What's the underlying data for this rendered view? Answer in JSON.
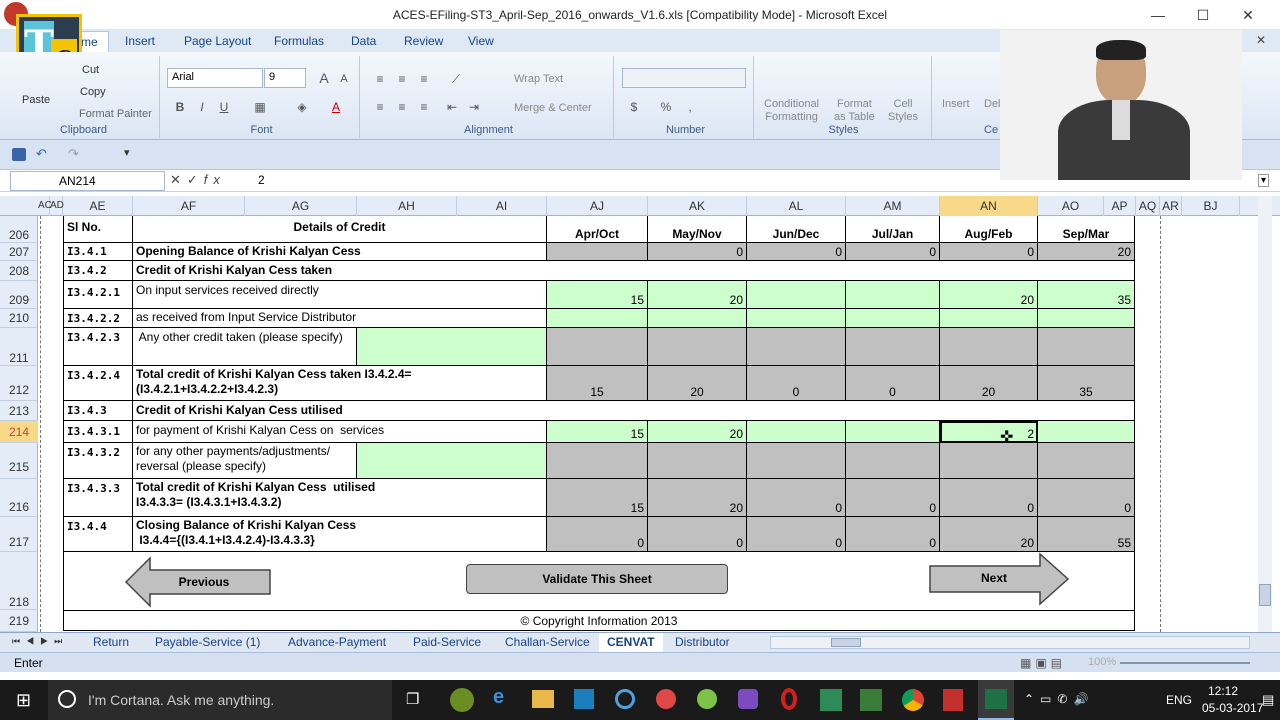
{
  "window": {
    "title": "ACES-EFiling-ST3_April-Sep_2016_onwards_V1.6.xls  [Compatibility Mode] - Microsoft Excel"
  },
  "ribbon_tabs": [
    "me",
    "Insert",
    "Page Layout",
    "Formulas",
    "Data",
    "Review",
    "View"
  ],
  "ribbon": {
    "clipboard": {
      "paste": "Paste",
      "cut": "Cut",
      "copy": "Copy",
      "format_painter": "Format Painter",
      "label": "Clipboard"
    },
    "font": {
      "name": "Arial",
      "size": "9",
      "label": "Font",
      "bold": "B",
      "italic": "I",
      "underline": "U",
      "grow": "A",
      "shrink": "A"
    },
    "alignment": {
      "wrap_text": "Wrap Text",
      "merge_center": "Merge & Center",
      "label": "Alignment"
    },
    "number": {
      "label": "Number",
      "currency": "$",
      "percent": "%",
      "comma": ","
    },
    "styles": {
      "conditional": "Conditional",
      "formatting": "Formatting",
      "format": "Format",
      "as_table": "as Table",
      "cell": "Cell",
      "styles_word": "Styles",
      "label": "Styles"
    },
    "cells": {
      "insert": "Insert",
      "delete": "Del",
      "label": "Ce"
    }
  },
  "formula_bar": {
    "name_box": "AN214",
    "fx": "fx",
    "value": "2"
  },
  "columns": [
    "AC",
    "AD",
    "AE",
    "AF",
    "AG",
    "AH",
    "AI",
    "AJ",
    "AK",
    "AL",
    "AM",
    "AN",
    "AO",
    "AP",
    "AQ",
    "AR",
    "BJ"
  ],
  "rows": [
    "206",
    "207",
    "208",
    "209",
    "210",
    "211",
    "212",
    "213",
    "214",
    "215",
    "216",
    "217",
    "218",
    "219"
  ],
  "table": {
    "header": {
      "sl": "Sl No.",
      "details": "Details of Credit",
      "months": [
        "Apr/Oct",
        "May/Nov",
        "Jun/Dec",
        "Jul/Jan",
        "Aug/Feb",
        "Sep/Mar"
      ]
    },
    "r207": {
      "sl": "I3.4.1",
      "desc": "Opening Balance of Krishi Kalyan Cess",
      "v": [
        "",
        "0",
        "0",
        "0",
        "0",
        "20"
      ]
    },
    "r208": {
      "sl": "I3.4.2",
      "desc": "Credit of Krishi Kalyan Cess taken"
    },
    "r209": {
      "sl": "I3.4.2.1",
      "desc": "On input services received directly",
      "v": [
        "15",
        "20",
        "",
        "",
        "20",
        "35"
      ]
    },
    "r210": {
      "sl": "I3.4.2.2",
      "desc": "as received from Input Service Distributor"
    },
    "r211": {
      "sl": "I3.4.2.3",
      "desc": " Any other credit taken (please specify)"
    },
    "r212": {
      "sl": "I3.4.2.4",
      "desc1": "Total credit of Krishi Kalyan Cess taken I3.4.2.4=",
      "desc2": "(I3.4.2.1+I3.4.2.2+I3.4.2.3)",
      "v": [
        "15",
        "20",
        "0",
        "0",
        "20",
        "35"
      ]
    },
    "r213": {
      "sl": "I3.4.3",
      "desc": "Credit of Krishi Kalyan Cess utilised"
    },
    "r214": {
      "sl": "I3.4.3.1",
      "desc": "for payment of Krishi Kalyan Cess on  services",
      "v": [
        "15",
        "20",
        "",
        "",
        "2",
        ""
      ]
    },
    "r215": {
      "sl": "I3.4.3.2",
      "desc1": "for any other payments/adjustments/",
      "desc2": "reversal (please specify)"
    },
    "r216": {
      "sl": "I3.4.3.3",
      "desc1": "Total credit of Krishi Kalyan Cess  utilised",
      "desc2": "I3.4.3.3= (I3.4.3.1+I3.4.3.2)",
      "v": [
        "15",
        "20",
        "0",
        "0",
        "0",
        "0"
      ]
    },
    "r217": {
      "sl": "I3.4.4",
      "desc1": "Closing Balance of Krishi Kalyan Cess",
      "desc2": " I3.4.4={(I3.4.1+I3.4.2.4)-I3.4.3.3}",
      "v": [
        "0",
        "0",
        "0",
        "0",
        "20",
        "55"
      ]
    }
  },
  "buttons": {
    "previous": "Previous",
    "validate": "Validate This Sheet",
    "next": "Next"
  },
  "copyright": "© Copyright Information 2013",
  "sheet_tabs": [
    "Return",
    "Payable-Service (1)",
    "Advance-Payment",
    "Paid-Service",
    "Challan-Service",
    "CENVAT",
    "Distributor"
  ],
  "active_sheet": "CENVAT",
  "status": {
    "mode": "Enter",
    "zoom": "100%"
  },
  "taskbar": {
    "search": "I'm Cortana. Ask me anything.",
    "lang": "ENG",
    "time": "12:12",
    "date": "05-03-2017"
  }
}
